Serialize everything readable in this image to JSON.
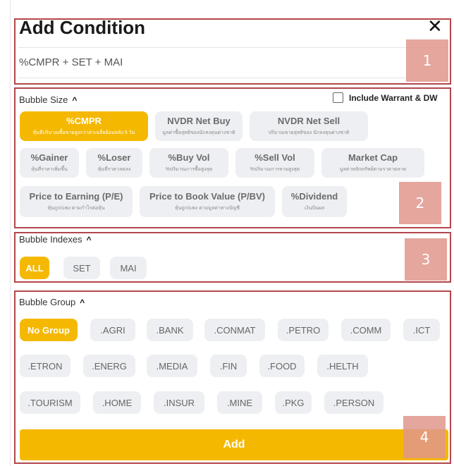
{
  "header": {
    "title": "Add Condition",
    "close_symbol": "✕"
  },
  "selection": {
    "text": "%CMPR + SET + MAI"
  },
  "bubble_size": {
    "title": "Bubble Size",
    "include_label": "Include Warrant & DW",
    "options": [
      {
        "label": "%CMPR",
        "sub": "หุ้นมีปริมาณซื้อขายสูงกว่าค่าเฉลี่ยย้อนหลัง 5 วัน",
        "active": true
      },
      {
        "label": "NVDR Net Buy",
        "sub": "มูลค่าซื้อสุทธิของนักลงทุนต่างชาติ",
        "active": false
      },
      {
        "label": "NVDR Net Sell",
        "sub": "ปริมาณขายสุทธิของ นักลงทุนต่างชาติ",
        "active": false
      },
      {
        "label": "%Gainer",
        "sub": "หุ้นที่ราคาเพิ่มขึ้น",
        "active": false
      },
      {
        "label": "%Loser",
        "sub": "หุ้นที่ราคาลดลง",
        "active": false
      },
      {
        "label": "%Buy Vol",
        "sub": "%ปริมาณการซื้อสูงสุด",
        "active": false
      },
      {
        "label": "%Sell Vol",
        "sub": "%ปริมาณการขายสูงสุด",
        "active": false
      },
      {
        "label": "Market Cap",
        "sub": "มูลค่าหลักทรัพย์ตามราคาตลาด",
        "active": false
      },
      {
        "label": "Price to Earning (P/E)",
        "sub": "หุ้นถูก/แพง ตามกำไรต่อหุ้น",
        "active": false
      },
      {
        "label": "Price to Book Value (P/BV)",
        "sub": "หุ้นถูก/แพง ตามมูลค่าทางบัญชี",
        "active": false
      },
      {
        "label": "%Dividend",
        "sub": "เงินปันผล",
        "active": false
      }
    ]
  },
  "bubble_indexes": {
    "title": "Bubble Indexes",
    "options": [
      {
        "label": "ALL",
        "active": true
      },
      {
        "label": "SET",
        "active": false
      },
      {
        "label": "MAI",
        "active": false
      }
    ]
  },
  "bubble_group": {
    "title": "Bubble Group",
    "options": [
      {
        "label": "No Group",
        "active": true
      },
      {
        "label": ".AGRI"
      },
      {
        "label": ".BANK"
      },
      {
        "label": ".CONMAT"
      },
      {
        "label": ".PETRO"
      },
      {
        "label": ".COMM"
      },
      {
        "label": ".ICT"
      },
      {
        "label": ".ETRON"
      },
      {
        "label": ".ENERG"
      },
      {
        "label": ".MEDIA"
      },
      {
        "label": ".FIN"
      },
      {
        "label": ".FOOD"
      },
      {
        "label": ".HELTH"
      },
      {
        "label": ".TOURISM"
      },
      {
        "label": ".HOME"
      },
      {
        "label": ".INSUR"
      },
      {
        "label": ".MINE"
      },
      {
        "label": ".PKG"
      },
      {
        "label": ".PERSON"
      }
    ]
  },
  "add_button": {
    "label": "Add"
  },
  "annotations": {
    "n1": "1",
    "n2": "2",
    "n3": "3",
    "n4": "4"
  },
  "colors": {
    "accent": "#f5b800",
    "chip_bg": "#eeeff2",
    "annotation_border": "#b2474c"
  }
}
